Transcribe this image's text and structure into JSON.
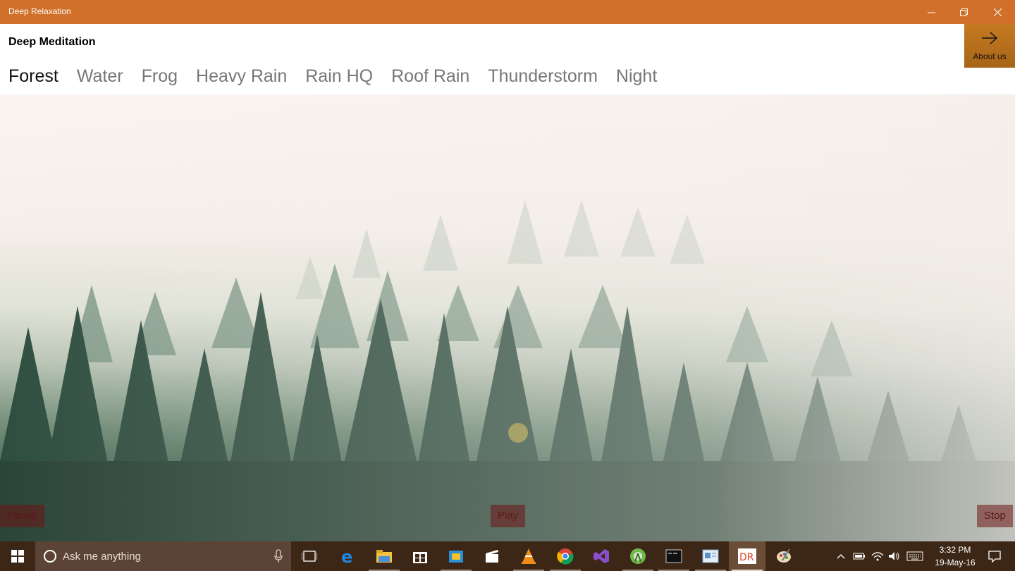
{
  "window": {
    "title": "Deep Relaxation"
  },
  "app": {
    "title": "Deep Meditation",
    "tabs": [
      {
        "label": "Forest",
        "active": true
      },
      {
        "label": "Water"
      },
      {
        "label": "Frog"
      },
      {
        "label": "Heavy Rain"
      },
      {
        "label": "Rain HQ"
      },
      {
        "label": "Roof Rain"
      },
      {
        "label": "Thunderstorm"
      },
      {
        "label": "Night"
      }
    ],
    "about_label": "About us"
  },
  "controls": {
    "pause": "Pause",
    "play": "Play",
    "stop": "Stop"
  },
  "taskbar": {
    "search_placeholder": "Ask me anything",
    "time": "3:32 PM",
    "date": "19-May-16",
    "pinned": [
      "task-view-icon",
      "edge-icon",
      "file-explorer-icon",
      "store-icon",
      "outlook-icon",
      "movies-icon",
      "vlc-icon",
      "chrome-icon",
      "visual-studio-icon",
      "android-studio-icon",
      "terminal-icon",
      "notepad-icon",
      "deep-relaxation-app-icon",
      "paint-icon"
    ],
    "app_badge": "DR"
  },
  "colors": {
    "titlebar": "#d0702a",
    "taskbar": "#3c2716",
    "accent": "#c57a20"
  }
}
